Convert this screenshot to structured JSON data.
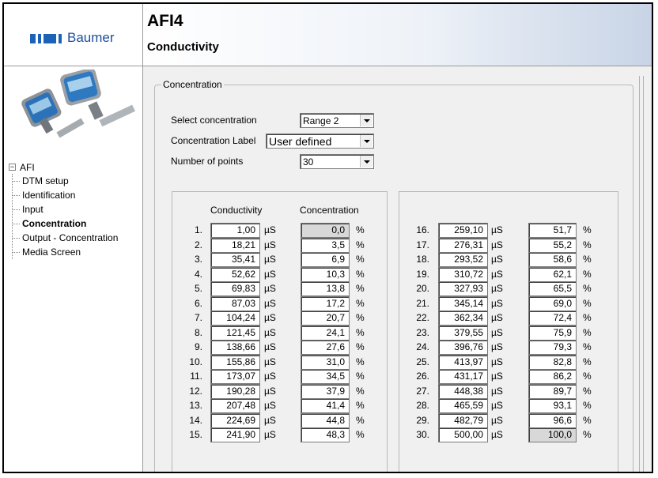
{
  "header": {
    "brand": "Baumer",
    "device": "AFI4",
    "page": "Conductivity"
  },
  "tree": {
    "root": "AFI",
    "items": [
      {
        "label": "DTM setup",
        "selected": false
      },
      {
        "label": "Identification",
        "selected": false
      },
      {
        "label": "Input",
        "selected": false
      },
      {
        "label": "Concentration",
        "selected": true
      },
      {
        "label": "Output - Concentration",
        "selected": false
      },
      {
        "label": "Media Screen",
        "selected": false
      }
    ]
  },
  "concentration": {
    "group_label": "Concentration",
    "select_label": "Select concentration",
    "select_value": "Range 2",
    "label_label": "Concentration Label",
    "label_value": "User defined",
    "points_label": "Number of points",
    "points_value": "30",
    "col_conductivity": "Conductivity",
    "col_concentration": "Concentration",
    "unit_cond": "µS",
    "unit_conc": "%",
    "rows": [
      {
        "n": "1.",
        "cond": "1,00",
        "conc": "0,0"
      },
      {
        "n": "2.",
        "cond": "18,21",
        "conc": "3,5"
      },
      {
        "n": "3.",
        "cond": "35,41",
        "conc": "6,9"
      },
      {
        "n": "4.",
        "cond": "52,62",
        "conc": "10,3"
      },
      {
        "n": "5.",
        "cond": "69,83",
        "conc": "13,8"
      },
      {
        "n": "6.",
        "cond": "87,03",
        "conc": "17,2"
      },
      {
        "n": "7.",
        "cond": "104,24",
        "conc": "20,7"
      },
      {
        "n": "8.",
        "cond": "121,45",
        "conc": "24,1"
      },
      {
        "n": "9.",
        "cond": "138,66",
        "conc": "27,6"
      },
      {
        "n": "10.",
        "cond": "155,86",
        "conc": "31,0"
      },
      {
        "n": "11.",
        "cond": "173,07",
        "conc": "34,5"
      },
      {
        "n": "12.",
        "cond": "190,28",
        "conc": "37,9"
      },
      {
        "n": "13.",
        "cond": "207,48",
        "conc": "41,4"
      },
      {
        "n": "14.",
        "cond": "224,69",
        "conc": "44,8"
      },
      {
        "n": "15.",
        "cond": "241,90",
        "conc": "48,3"
      },
      {
        "n": "16.",
        "cond": "259,10",
        "conc": "51,7"
      },
      {
        "n": "17.",
        "cond": "276,31",
        "conc": "55,2"
      },
      {
        "n": "18.",
        "cond": "293,52",
        "conc": "58,6"
      },
      {
        "n": "19.",
        "cond": "310,72",
        "conc": "62,1"
      },
      {
        "n": "20.",
        "cond": "327,93",
        "conc": "65,5"
      },
      {
        "n": "21.",
        "cond": "345,14",
        "conc": "69,0"
      },
      {
        "n": "22.",
        "cond": "362,34",
        "conc": "72,4"
      },
      {
        "n": "23.",
        "cond": "379,55",
        "conc": "75,9"
      },
      {
        "n": "24.",
        "cond": "396,76",
        "conc": "79,3"
      },
      {
        "n": "25.",
        "cond": "413,97",
        "conc": "82,8"
      },
      {
        "n": "26.",
        "cond": "431,17",
        "conc": "86,2"
      },
      {
        "n": "27.",
        "cond": "448,38",
        "conc": "89,7"
      },
      {
        "n": "28.",
        "cond": "465,59",
        "conc": "93,1"
      },
      {
        "n": "29.",
        "cond": "482,79",
        "conc": "96,6"
      },
      {
        "n": "30.",
        "cond": "500,00",
        "conc": "100,0"
      }
    ]
  },
  "colors": {
    "brand_blue": "#1c63b7",
    "readonly_field": "#d8d8d8"
  }
}
